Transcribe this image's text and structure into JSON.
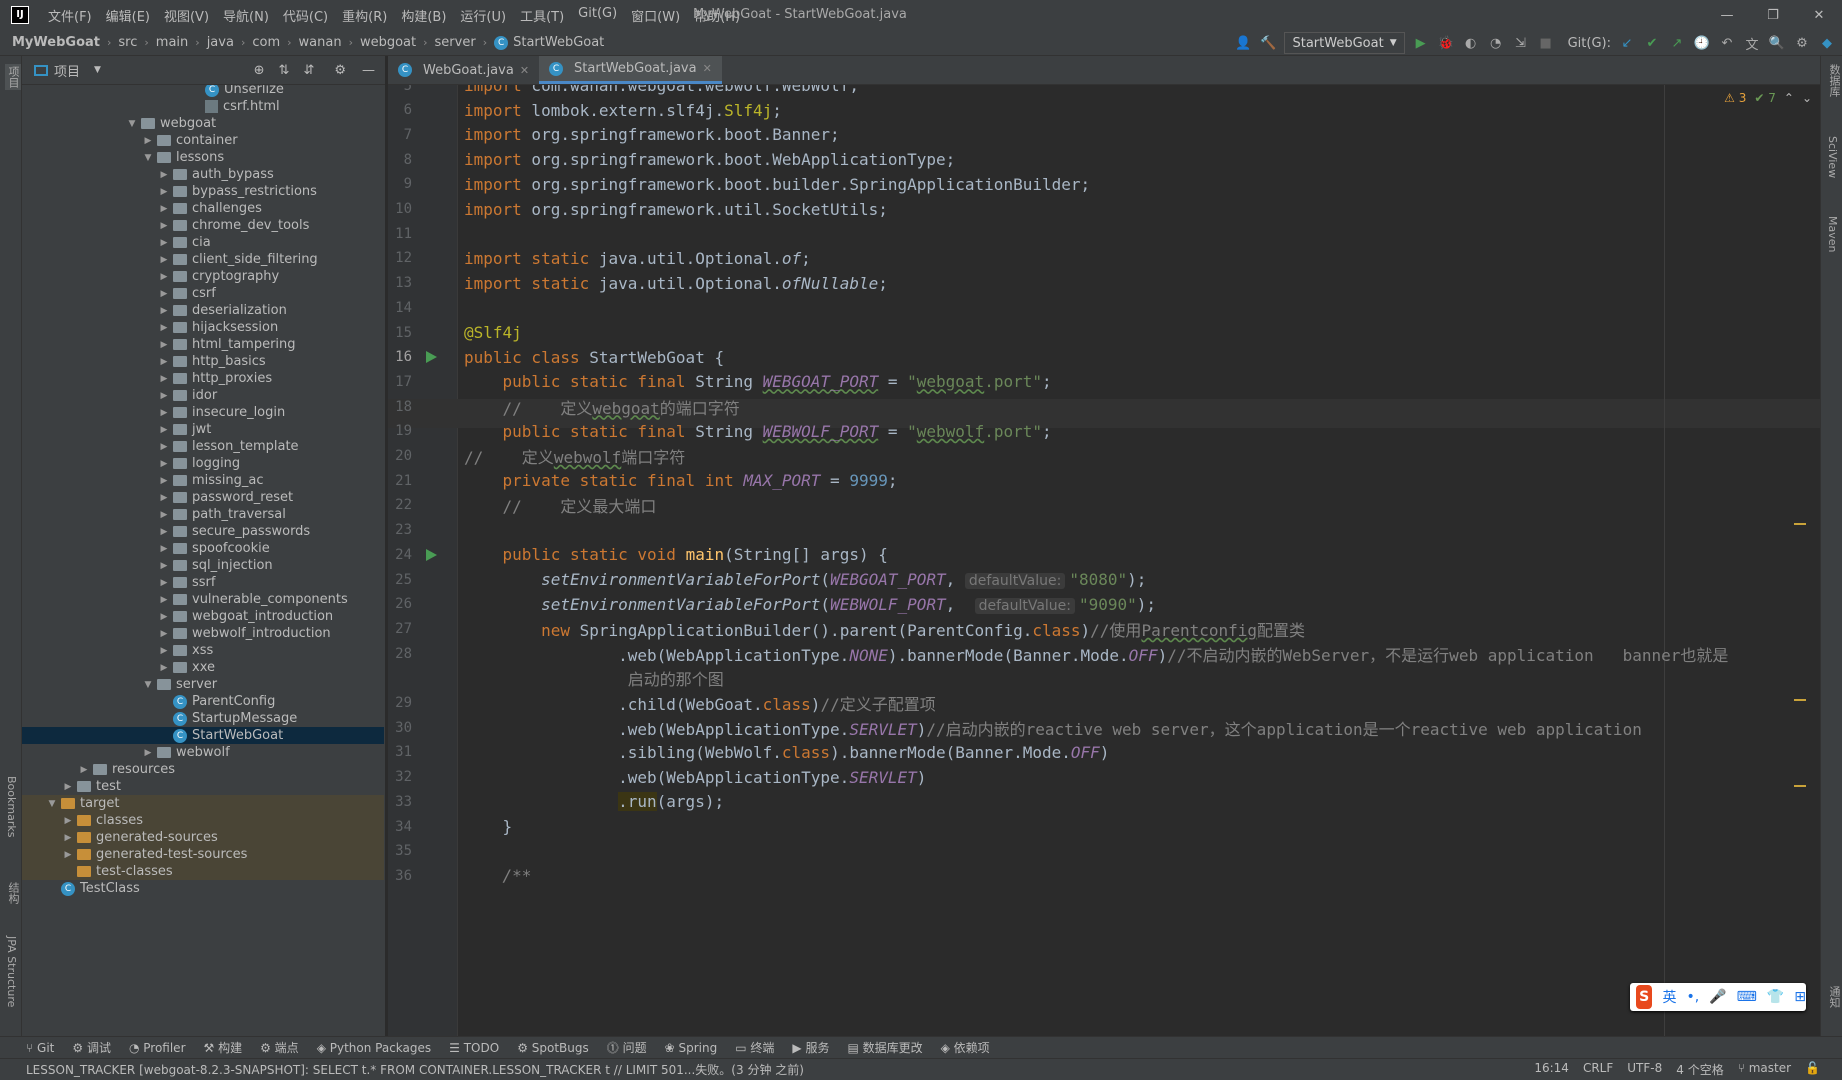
{
  "window": {
    "title": "MyWebGoat - StartWebGoat.java",
    "logo": "IJ",
    "controls": [
      "—",
      "❐",
      "✕"
    ]
  },
  "menu": [
    "文件(F)",
    "编辑(E)",
    "视图(V)",
    "导航(N)",
    "代码(C)",
    "重构(R)",
    "构建(B)",
    "运行(U)",
    "工具(T)",
    "Git(G)",
    "窗口(W)",
    "帮助(H)"
  ],
  "breadcrumb": [
    "MyWebGoat",
    "src",
    "main",
    "java",
    "com",
    "wanan",
    "webgoat",
    "server",
    "StartWebGoat"
  ],
  "toolbar": {
    "run_config": "StartWebGoat",
    "git_label": "Git(G):"
  },
  "project_panel": {
    "title": "项目"
  },
  "tree": [
    {
      "label": "Unserlize",
      "type": "class",
      "depth": 10
    },
    {
      "label": "csrf.html",
      "type": "html",
      "depth": 10
    },
    {
      "label": "webgoat",
      "type": "folder",
      "depth": 6,
      "open": true
    },
    {
      "label": "container",
      "type": "folder",
      "depth": 7
    },
    {
      "label": "lessons",
      "type": "folder",
      "depth": 7,
      "open": true
    },
    {
      "label": "auth_bypass",
      "type": "folder",
      "depth": 8
    },
    {
      "label": "bypass_restrictions",
      "type": "folder",
      "depth": 8
    },
    {
      "label": "challenges",
      "type": "folder",
      "depth": 8
    },
    {
      "label": "chrome_dev_tools",
      "type": "folder",
      "depth": 8
    },
    {
      "label": "cia",
      "type": "folder",
      "depth": 8
    },
    {
      "label": "client_side_filtering",
      "type": "folder",
      "depth": 8
    },
    {
      "label": "cryptography",
      "type": "folder",
      "depth": 8
    },
    {
      "label": "csrf",
      "type": "folder",
      "depth": 8
    },
    {
      "label": "deserialization",
      "type": "folder",
      "depth": 8
    },
    {
      "label": "hijacksession",
      "type": "folder",
      "depth": 8
    },
    {
      "label": "html_tampering",
      "type": "folder",
      "depth": 8
    },
    {
      "label": "http_basics",
      "type": "folder",
      "depth": 8
    },
    {
      "label": "http_proxies",
      "type": "folder",
      "depth": 8
    },
    {
      "label": "idor",
      "type": "folder",
      "depth": 8
    },
    {
      "label": "insecure_login",
      "type": "folder",
      "depth": 8
    },
    {
      "label": "jwt",
      "type": "folder",
      "depth": 8
    },
    {
      "label": "lesson_template",
      "type": "folder",
      "depth": 8
    },
    {
      "label": "logging",
      "type": "folder",
      "depth": 8
    },
    {
      "label": "missing_ac",
      "type": "folder",
      "depth": 8
    },
    {
      "label": "password_reset",
      "type": "folder",
      "depth": 8
    },
    {
      "label": "path_traversal",
      "type": "folder",
      "depth": 8
    },
    {
      "label": "secure_passwords",
      "type": "folder",
      "depth": 8
    },
    {
      "label": "spoofcookie",
      "type": "folder",
      "depth": 8
    },
    {
      "label": "sql_injection",
      "type": "folder",
      "depth": 8
    },
    {
      "label": "ssrf",
      "type": "folder",
      "depth": 8
    },
    {
      "label": "vulnerable_components",
      "type": "folder",
      "depth": 8
    },
    {
      "label": "webgoat_introduction",
      "type": "folder",
      "depth": 8
    },
    {
      "label": "webwolf_introduction",
      "type": "folder",
      "depth": 8
    },
    {
      "label": "xss",
      "type": "folder",
      "depth": 8
    },
    {
      "label": "xxe",
      "type": "folder",
      "depth": 8
    },
    {
      "label": "server",
      "type": "folder",
      "depth": 7,
      "open": true
    },
    {
      "label": "ParentConfig",
      "type": "class",
      "depth": 8
    },
    {
      "label": "StartupMessage",
      "type": "class",
      "depth": 8
    },
    {
      "label": "StartWebGoat",
      "type": "class",
      "depth": 8,
      "selected": true
    },
    {
      "label": "webwolf",
      "type": "folder",
      "depth": 7
    },
    {
      "label": "resources",
      "type": "folder",
      "depth": 3
    },
    {
      "label": "test",
      "type": "folder",
      "depth": 2
    },
    {
      "label": "target",
      "type": "folder-orange",
      "depth": 1,
      "open": true,
      "target": true
    },
    {
      "label": "classes",
      "type": "folder-orange",
      "depth": 2,
      "target": true
    },
    {
      "label": "generated-sources",
      "type": "folder-orange",
      "depth": 2,
      "target": true
    },
    {
      "label": "generated-test-sources",
      "type": "folder-orange",
      "depth": 2,
      "target": true
    },
    {
      "label": "test-classes",
      "type": "folder-orange",
      "depth": 2,
      "target": true,
      "leaf": true
    },
    {
      "label": "TestClass",
      "type": "class",
      "depth": 1
    }
  ],
  "tabs": [
    {
      "label": "WebGoat.java",
      "active": false
    },
    {
      "label": "StartWebGoat.java",
      "active": true
    }
  ],
  "editor": {
    "warnings": "3",
    "ok_checks": "7"
  },
  "code_lines": [
    {
      "n": "5",
      "html": "<span class='kw'>import</span> com.wanan.webgoat.webwolf.WebWolf;"
    },
    {
      "n": "6",
      "html": "<span class='kw'>import</span> lombok.extern.slf4j.<span class='an'>Slf4j</span>;"
    },
    {
      "n": "7",
      "html": "<span class='kw'>import</span> org.springframework.boot.Banner;"
    },
    {
      "n": "8",
      "html": "<span class='kw'>import</span> org.springframework.boot.WebApplicationType;"
    },
    {
      "n": "9",
      "html": "<span class='kw'>import</span> org.springframework.boot.builder.SpringApplicationBuilder;"
    },
    {
      "n": "10",
      "html": "<span class='kw'>import</span> org.springframework.util.SocketUtils;"
    },
    {
      "n": "11",
      "html": ""
    },
    {
      "n": "12",
      "html": "<span class='kw'>import static</span> java.util.Optional.<span class='it'>of</span>;"
    },
    {
      "n": "13",
      "html": "<span class='kw'>import static</span> java.util.Optional.<span class='it'>ofNullable</span>;"
    },
    {
      "n": "14",
      "html": ""
    },
    {
      "n": "15",
      "html": "<span class='an'>@Slf4j</span>"
    },
    {
      "n": "16",
      "html": "<span class='kw'>public class</span> StartWebGoat {",
      "run": true,
      "cur": true
    },
    {
      "n": "17",
      "html": "    <span class='kw'>public static final</span> String <span class='fi wavy'>WEBGOAT_PORT</span> = <span class='st'>\"<span class='wavy'>webgoat</span>.port\"</span>;"
    },
    {
      "n": "18",
      "html": "    <span class='cm'>//    定义<span class='wavy'>webgoat</span>的端口字符</span>"
    },
    {
      "n": "19",
      "html": "    <span class='kw'>public static final</span> String <span class='fi wavy'>WEBWOLF_PORT</span> = <span class='st'>\"<span class='wavy'>webwolf</span>.port\"</span>;"
    },
    {
      "n": "20",
      "html": "<span class='cm'>//    定义<span class='wavy'>webwolf</span>端口字符</span>"
    },
    {
      "n": "21",
      "html": "    <span class='kw'>private static final int</span> <span class='fi'>MAX_PORT</span> = <span class='nm'>9999</span>;"
    },
    {
      "n": "22",
      "html": "    <span class='cm'>//    定义最大端口</span>"
    },
    {
      "n": "23",
      "html": ""
    },
    {
      "n": "24",
      "html": "    <span class='kw'>public static void</span> <span style='color:#ffc66d'>main</span>(String[] args) {",
      "run": true
    },
    {
      "n": "25",
      "html": "        <span class='it'>setEnvironmentVariableForPort</span>(<span class='fi'>WEBGOAT_PORT</span>, <span class='hint'>defaultValue:</span><span class='st'>\"8080\"</span>);"
    },
    {
      "n": "26",
      "html": "        <span class='it'>setEnvironmentVariableForPort</span>(<span class='fi'>WEBWOLF_PORT</span>,  <span class='hint'>defaultValue:</span><span class='st'>\"9090\"</span>);"
    },
    {
      "n": "27",
      "html": "        <span class='kw'>new</span> SpringApplicationBuilder().parent(ParentConfig.<span class='kw'>class</span>)<span class='cm'>//使用<span class='wavy'>Parentconfig</span>配置类</span>"
    },
    {
      "n": "28",
      "html": "                .web(WebApplicationType.<span class='fi'>NONE</span>).bannerMode(Banner.Mode.<span class='fi'>OFF</span>)<span class='cm'>//不启动内嵌的WebServer，不是运行web application   banner也就是</span>"
    },
    {
      "n": "",
      "html": "                 <span class='cm'>启动的那个图</span>"
    },
    {
      "n": "29",
      "html": "                .child(WebGoat.<span class='kw'>class</span>)<span class='cm'>//定义子配置项</span>"
    },
    {
      "n": "30",
      "html": "                .web(WebApplicationType.<span class='fi'>SERVLET</span>)<span class='cm'>//启动内嵌的reactive web server，这个application是一个reactive web application</span>"
    },
    {
      "n": "31",
      "html": "                .sibling(WebWolf.<span class='kw'>class</span>).bannerMode(Banner.Mode.<span class='fi'>OFF</span>)"
    },
    {
      "n": "32",
      "html": "                .web(WebApplicationType.<span class='fi'>SERVLET</span>)"
    },
    {
      "n": "33",
      "html": "                <span style='background:#3b3514'>.run</span>(args);"
    },
    {
      "n": "34",
      "html": "    }"
    },
    {
      "n": "35",
      "html": ""
    },
    {
      "n": "36",
      "html": "    <span class='cm it'>/**</span>"
    }
  ],
  "bottom_tools": [
    "Git",
    "调试",
    "Profiler",
    "构建",
    "端点",
    "Python Packages",
    "TODO",
    "SpotBugs",
    "问题",
    "Spring",
    "终端",
    "服务",
    "数据库更改",
    "依赖项"
  ],
  "status": {
    "message": "LESSON_TRACKER [webgoat-8.2.3-SNAPSHOT]: SELECT t.* FROM CONTAINER.LESSON_TRACKER t // LIMIT 501...失败。(3 分钟 之前)",
    "position": "16:14",
    "line_sep": "CRLF",
    "encoding": "UTF-8",
    "indent": "4 个空格",
    "branch": "master"
  },
  "side_labels": {
    "left": [
      "项目",
      "Bookmarks",
      "结构",
      "JPA Structure"
    ],
    "right": [
      "数据库",
      "SciView",
      "Maven",
      "通知"
    ]
  },
  "ime": {
    "lang": "英",
    "icons": [
      "•,",
      "🎤",
      "⌨",
      "👕",
      "⊞"
    ]
  }
}
